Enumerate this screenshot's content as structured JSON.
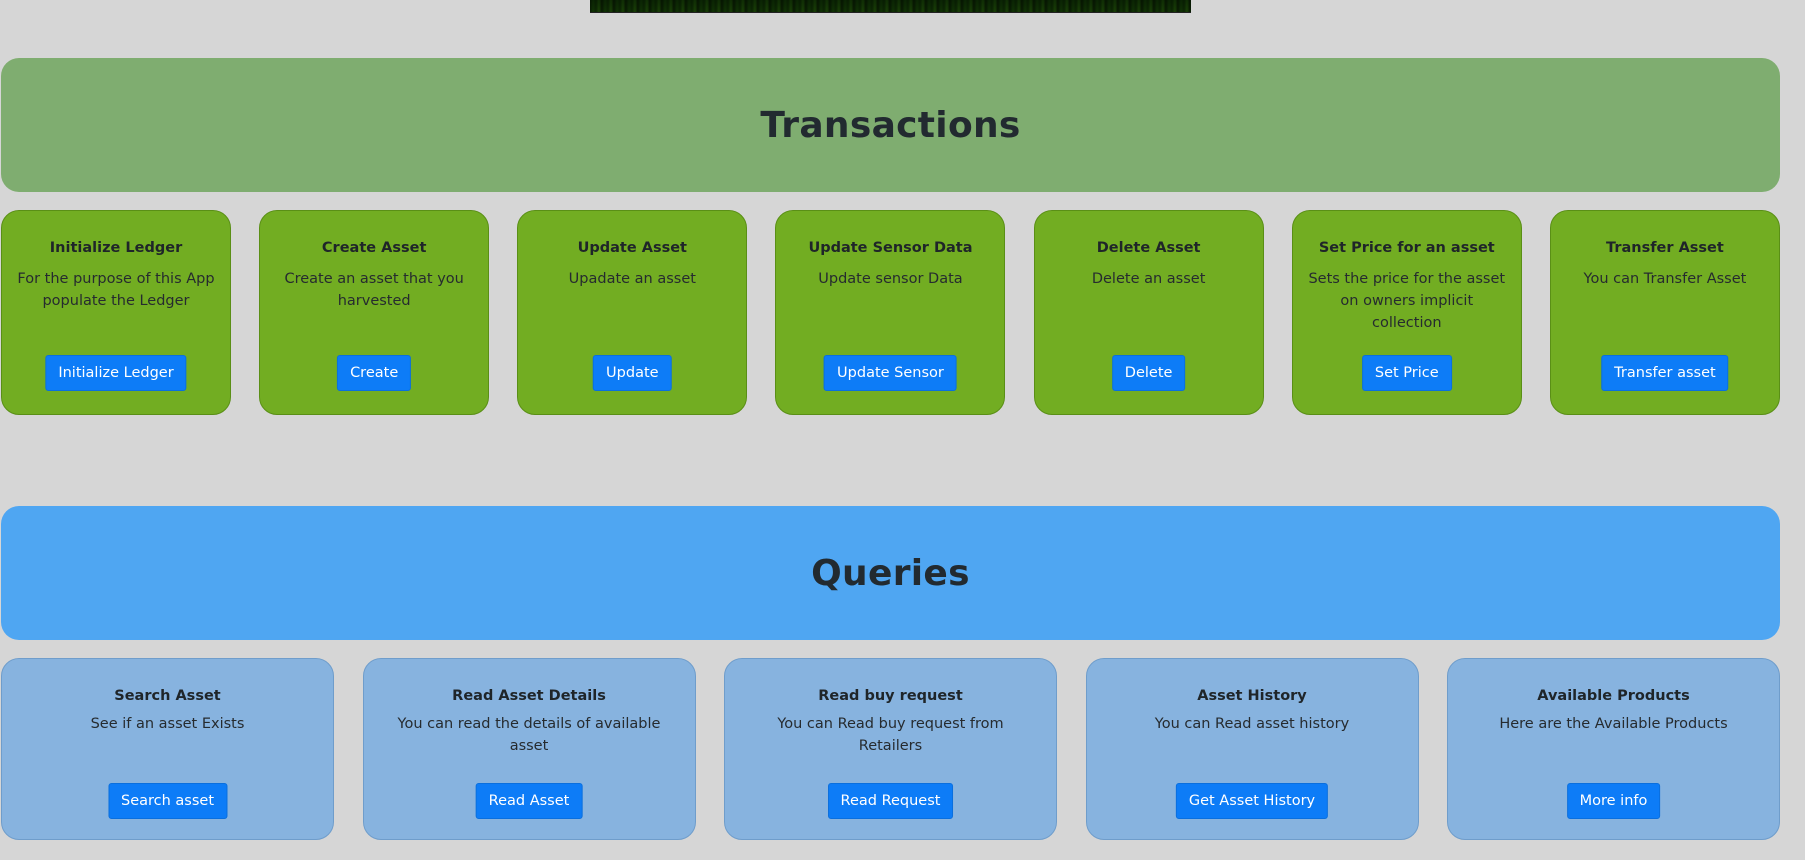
{
  "hero": {
    "alt": "crop field image"
  },
  "transactions": {
    "title": "Transactions",
    "color": "#7fad70",
    "card_color": "#72ad22",
    "cards": [
      {
        "title": "Initialize Ledger",
        "text": "For the purpose of this App populate the Ledger",
        "button": "Initialize Ledger"
      },
      {
        "title": "Create Asset",
        "text": "Create an asset that you harvested",
        "button": "Create"
      },
      {
        "title": "Update Asset",
        "text": "Upadate an asset",
        "button": "Update"
      },
      {
        "title": "Update Sensor Data",
        "text": "Update sensor Data",
        "button": "Update Sensor"
      },
      {
        "title": "Delete Asset",
        "text": "Delete an asset",
        "button": "Delete"
      },
      {
        "title": "Set Price for an asset",
        "text": "Sets the price for the asset on owners implicit collection",
        "button": "Set Price"
      },
      {
        "title": "Transfer Asset",
        "text": "You can Transfer Asset",
        "button": "Transfer asset"
      }
    ]
  },
  "queries": {
    "title": "Queries",
    "color": "#4fa6f2",
    "card_color": "#87b3df",
    "cards": [
      {
        "title": "Search Asset",
        "text": "See if an asset Exists",
        "button": "Search asset"
      },
      {
        "title": "Read Asset Details",
        "text": "You can read the details of available asset",
        "button": "Read Asset"
      },
      {
        "title": "Read buy request",
        "text": "You can Read buy request from Retailers",
        "button": "Read Request"
      },
      {
        "title": "Asset History",
        "text": "You can Read asset history",
        "button": "Get Asset History"
      },
      {
        "title": "Available Products",
        "text": "Here are the Available Products",
        "button": "More info"
      }
    ]
  },
  "button_color": "#0d7cf7"
}
